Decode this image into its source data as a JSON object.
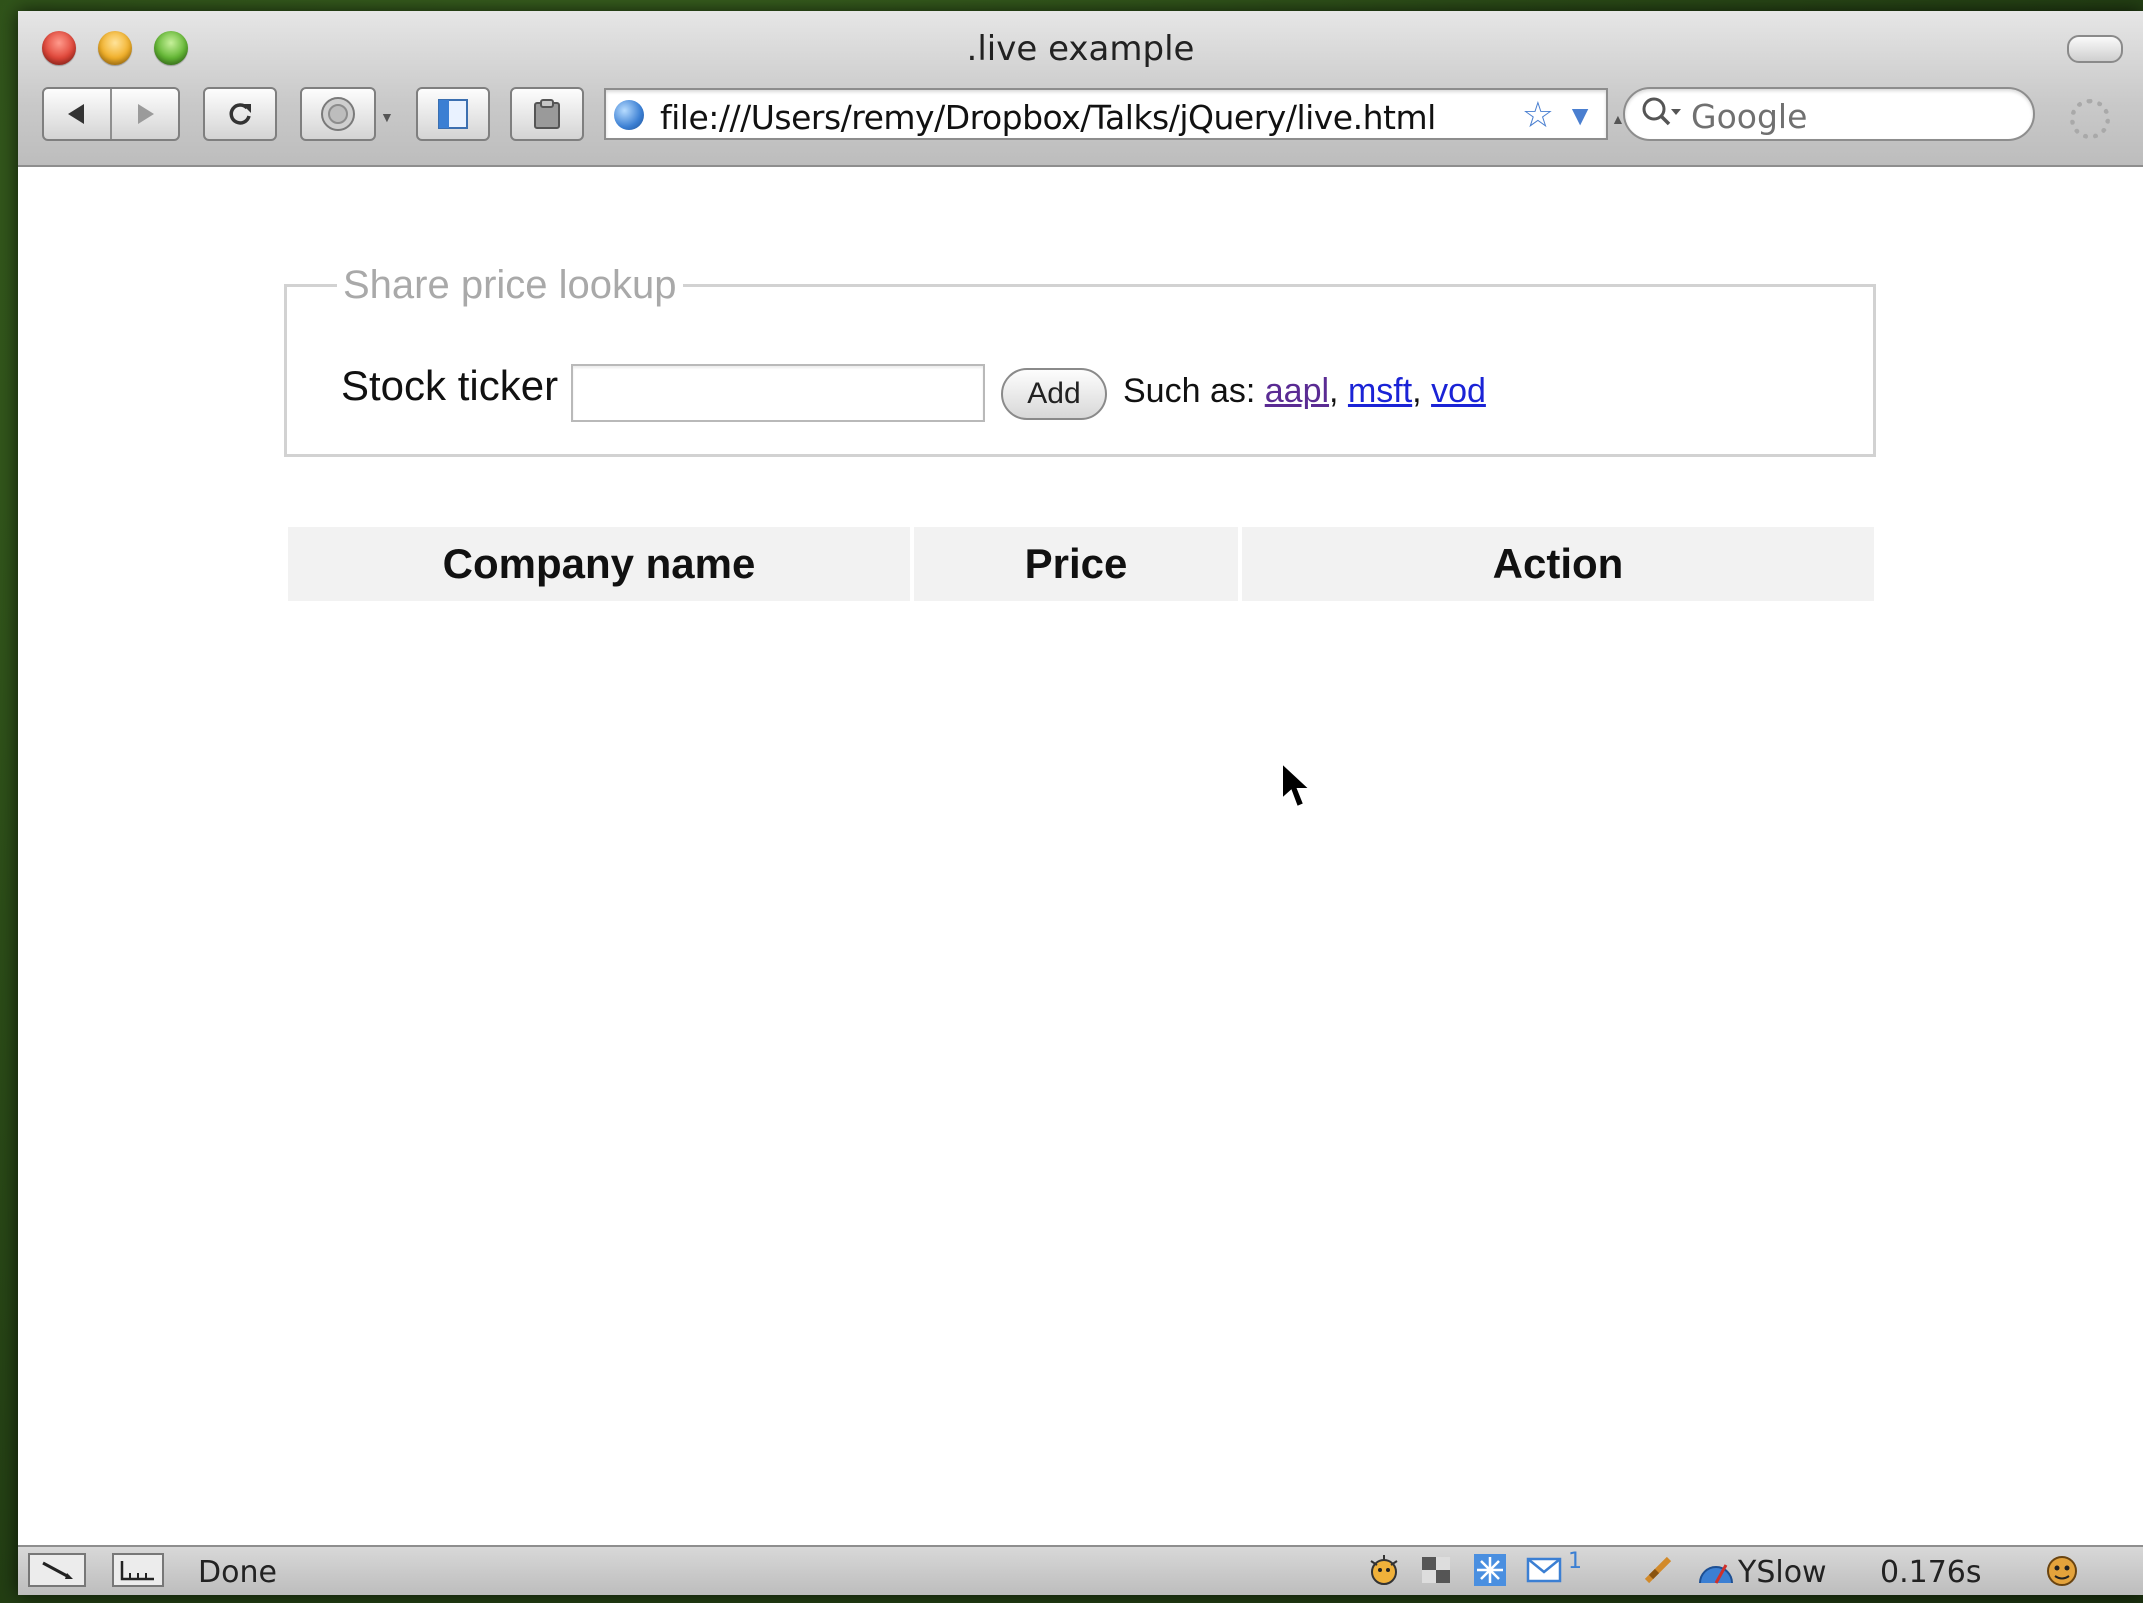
{
  "window": {
    "title": ".live example"
  },
  "toolbar": {
    "back_icon": "back-arrow-icon",
    "forward_icon": "forward-arrow-icon",
    "reload_icon": "reload-icon",
    "home_icon": "home-icon",
    "url": "file:///Users/remy/Dropbox/Talks/jQuery/live.html",
    "search_placeholder": "Google"
  },
  "form": {
    "legend": "Share price lookup",
    "label": "Stock ticker",
    "input_value": "",
    "add_label": "Add",
    "hint_prefix": "Such as: ",
    "examples": [
      "aapl",
      "msft",
      "vod"
    ],
    "separator": ","
  },
  "table": {
    "headers": [
      "Company name",
      "Price",
      "Action"
    ],
    "rows": []
  },
  "status_bar": {
    "status_text": "Done",
    "yslow_label": "YSlow",
    "mail_count": "1",
    "load_time": "0.176s"
  },
  "colors": {
    "link": "#1a23d6",
    "link_visited": "#5a2b93",
    "legend": "#a9a9a9",
    "header_bg": "#f2f2f2"
  }
}
